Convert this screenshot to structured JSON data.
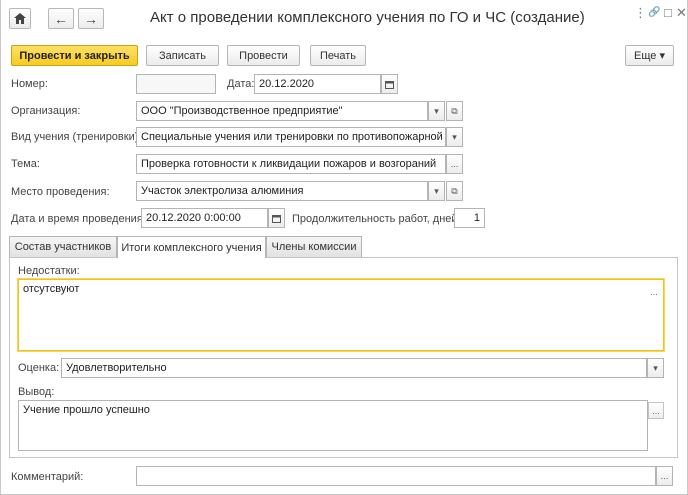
{
  "window": {
    "title": "Акт о проведении комплексного учения по ГО и ЧС (создание)",
    "controls": [
      "⋮",
      "🔗",
      "□",
      "✕"
    ]
  },
  "nav": {
    "home": "⌂",
    "back": "←",
    "forward": "→"
  },
  "toolbar": {
    "post_close": "Провести и закрыть",
    "save": "Записать",
    "post": "Провести",
    "print": "Печать",
    "more": "Еще ▾"
  },
  "form": {
    "number_label": "Номер:",
    "number_value": "",
    "date_label": "Дата:",
    "date_value": "20.12.2020",
    "organization_label": "Организация:",
    "organization_value": "ООО \"Производственное предприятие\"",
    "exercise_type_label": "Вид учения (тренировки):",
    "exercise_type_value": "Специальные учения или тренировки по противопожарной защи",
    "topic_label": "Тема:",
    "topic_value": "Проверка готовности к ликвидации пожаров и возгораний",
    "location_label": "Место проведения:",
    "location_value": "Участок электролиза алюминия",
    "datetime_label": "Дата и время проведения:",
    "datetime_value": "20.12.2020  0:00:00",
    "duration_label": "Продолжительность работ, дней:",
    "duration_value": "1"
  },
  "tabs": [
    {
      "label": "Состав участников"
    },
    {
      "label": "Итоги комплексного учения"
    },
    {
      "label": "Члены комиссии"
    }
  ],
  "results": {
    "shortcomings_label": "Недостатки:",
    "shortcomings_value": "отсутсвуют",
    "rating_label": "Оценка:",
    "rating_value": "Удовлетворительно",
    "conclusion_label": "Вывод:",
    "conclusion_value": "Учение прошло успешно"
  },
  "comment": {
    "label": "Комментарий:",
    "value": ""
  },
  "icons": {
    "dropdown": "▾",
    "open": "⧉",
    "ellipsis": "...",
    "calendar": "calendar-icon"
  }
}
